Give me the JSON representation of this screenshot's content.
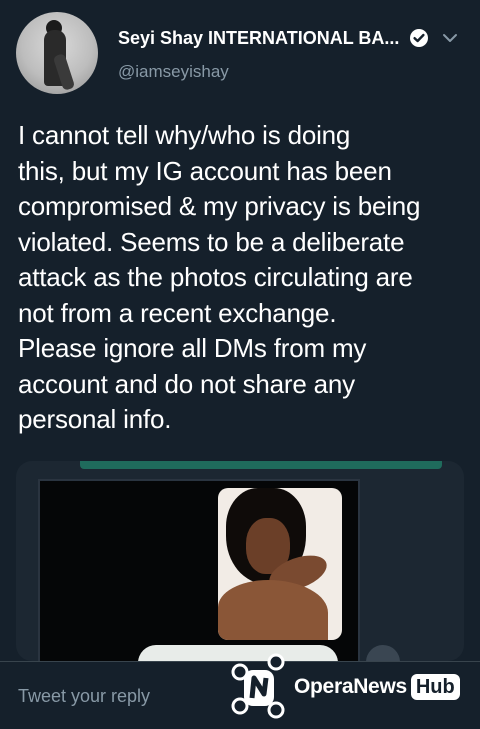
{
  "tweet": {
    "display_name": "Seyi Shay INTERNATIONAL BA...",
    "handle": "@iamseyishay",
    "verified_icon": "verified-badge-icon",
    "more_icon": "chevron-down-icon",
    "text": "I cannot tell why/who is doing\nthis, but my IG account has been\ncompromised & my privacy is being\nviolated. Seems to be a deliberate\nattack as the photos circulating are\nnot from a recent exchange.\nPlease ignore all DMs from my\naccount and do not share any\npersonal info."
  },
  "reply": {
    "placeholder": "Tweet your reply"
  },
  "watermark": {
    "brand": "OperaNews",
    "brand_suffix": "Hub"
  },
  "colors": {
    "background": "#15202b",
    "secondary_text": "#8899a6",
    "accent": "#1da1f2"
  }
}
